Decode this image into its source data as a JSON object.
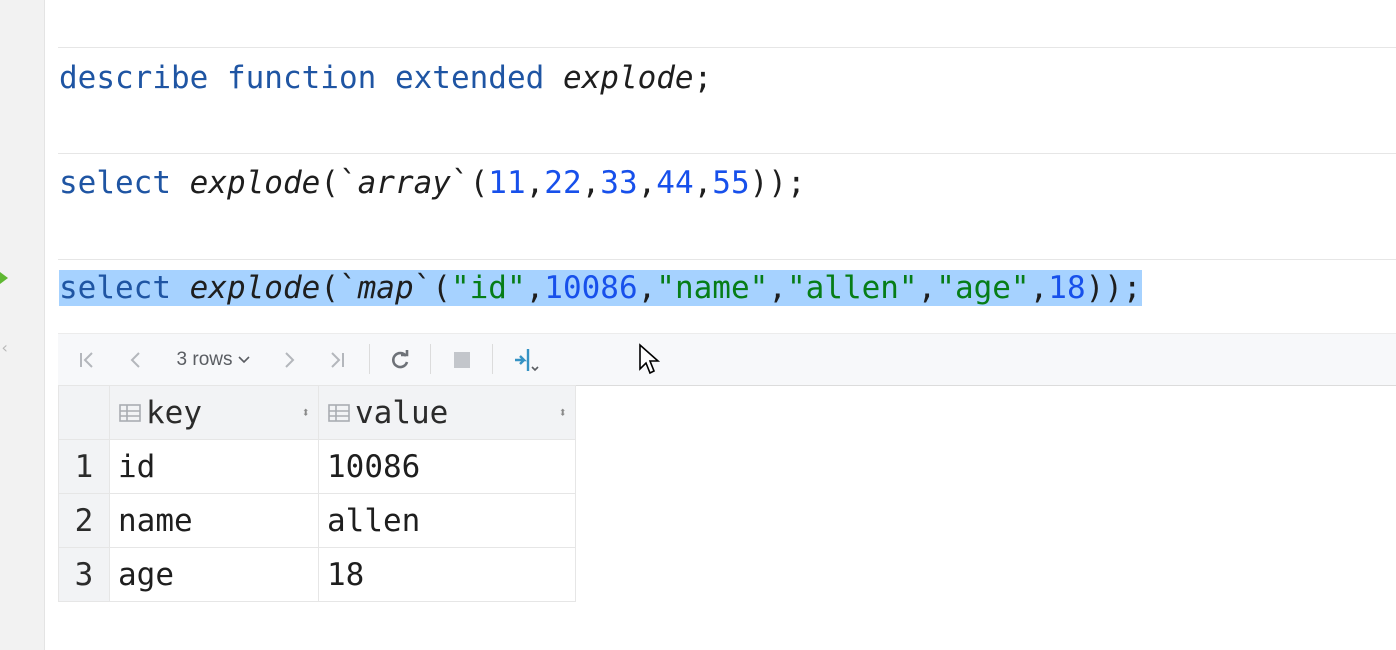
{
  "editor": {
    "lines": [
      {
        "id": "describe",
        "parts": [
          {
            "t": "describe",
            "c": "kw"
          },
          {
            "t": " ",
            "c": ""
          },
          {
            "t": "function",
            "c": "kw"
          },
          {
            "t": " ",
            "c": ""
          },
          {
            "t": "extended",
            "c": "kw"
          },
          {
            "t": " ",
            "c": ""
          },
          {
            "t": "explode",
            "c": "it"
          },
          {
            "t": ";",
            "c": ""
          }
        ]
      },
      {
        "id": "array",
        "parts": [
          {
            "t": "select",
            "c": "kw"
          },
          {
            "t": " ",
            "c": ""
          },
          {
            "t": "explode",
            "c": "it"
          },
          {
            "t": "(`",
            "c": ""
          },
          {
            "t": "array",
            "c": "it"
          },
          {
            "t": "`(",
            "c": ""
          },
          {
            "t": "11",
            "c": "num"
          },
          {
            "t": ",",
            "c": ""
          },
          {
            "t": "22",
            "c": "num"
          },
          {
            "t": ",",
            "c": ""
          },
          {
            "t": "33",
            "c": "num"
          },
          {
            "t": ",",
            "c": ""
          },
          {
            "t": "44",
            "c": "num"
          },
          {
            "t": ",",
            "c": ""
          },
          {
            "t": "55",
            "c": "num"
          },
          {
            "t": "));",
            "c": ""
          }
        ]
      },
      {
        "id": "map",
        "parts": [
          {
            "t": "select",
            "c": "kw"
          },
          {
            "t": " ",
            "c": ""
          },
          {
            "t": "explode",
            "c": "it"
          },
          {
            "t": "(`",
            "c": ""
          },
          {
            "t": "map",
            "c": "it"
          },
          {
            "t": "`(",
            "c": ""
          },
          {
            "t": "\"id\"",
            "c": "str"
          },
          {
            "t": ",",
            "c": ""
          },
          {
            "t": "10086",
            "c": "num"
          },
          {
            "t": ",",
            "c": ""
          },
          {
            "t": "\"name\"",
            "c": "str"
          },
          {
            "t": ",",
            "c": ""
          },
          {
            "t": "\"allen\"",
            "c": "str"
          },
          {
            "t": ",",
            "c": ""
          },
          {
            "t": "\"age\"",
            "c": "str"
          },
          {
            "t": ",",
            "c": ""
          },
          {
            "t": "18",
            "c": "num"
          },
          {
            "t": "));",
            "c": ""
          }
        ]
      }
    ]
  },
  "toolbar": {
    "rows_label": "3 rows",
    "icons": [
      "first-page-icon",
      "prev-page-icon",
      "next-page-icon",
      "last-page-icon",
      "refresh-icon",
      "stop-icon",
      "pin-tab-icon"
    ]
  },
  "grid": {
    "columns": [
      "key",
      "value"
    ],
    "rows": [
      {
        "n": "1",
        "key": "id",
        "value": "10086"
      },
      {
        "n": "2",
        "key": "name",
        "value": "allen"
      },
      {
        "n": "3",
        "key": "age",
        "value": "18"
      }
    ]
  },
  "colors": {
    "keyword": "#1f55a3",
    "number": "#1750eb",
    "string": "#067d17",
    "selection": "#a6d2ff"
  }
}
